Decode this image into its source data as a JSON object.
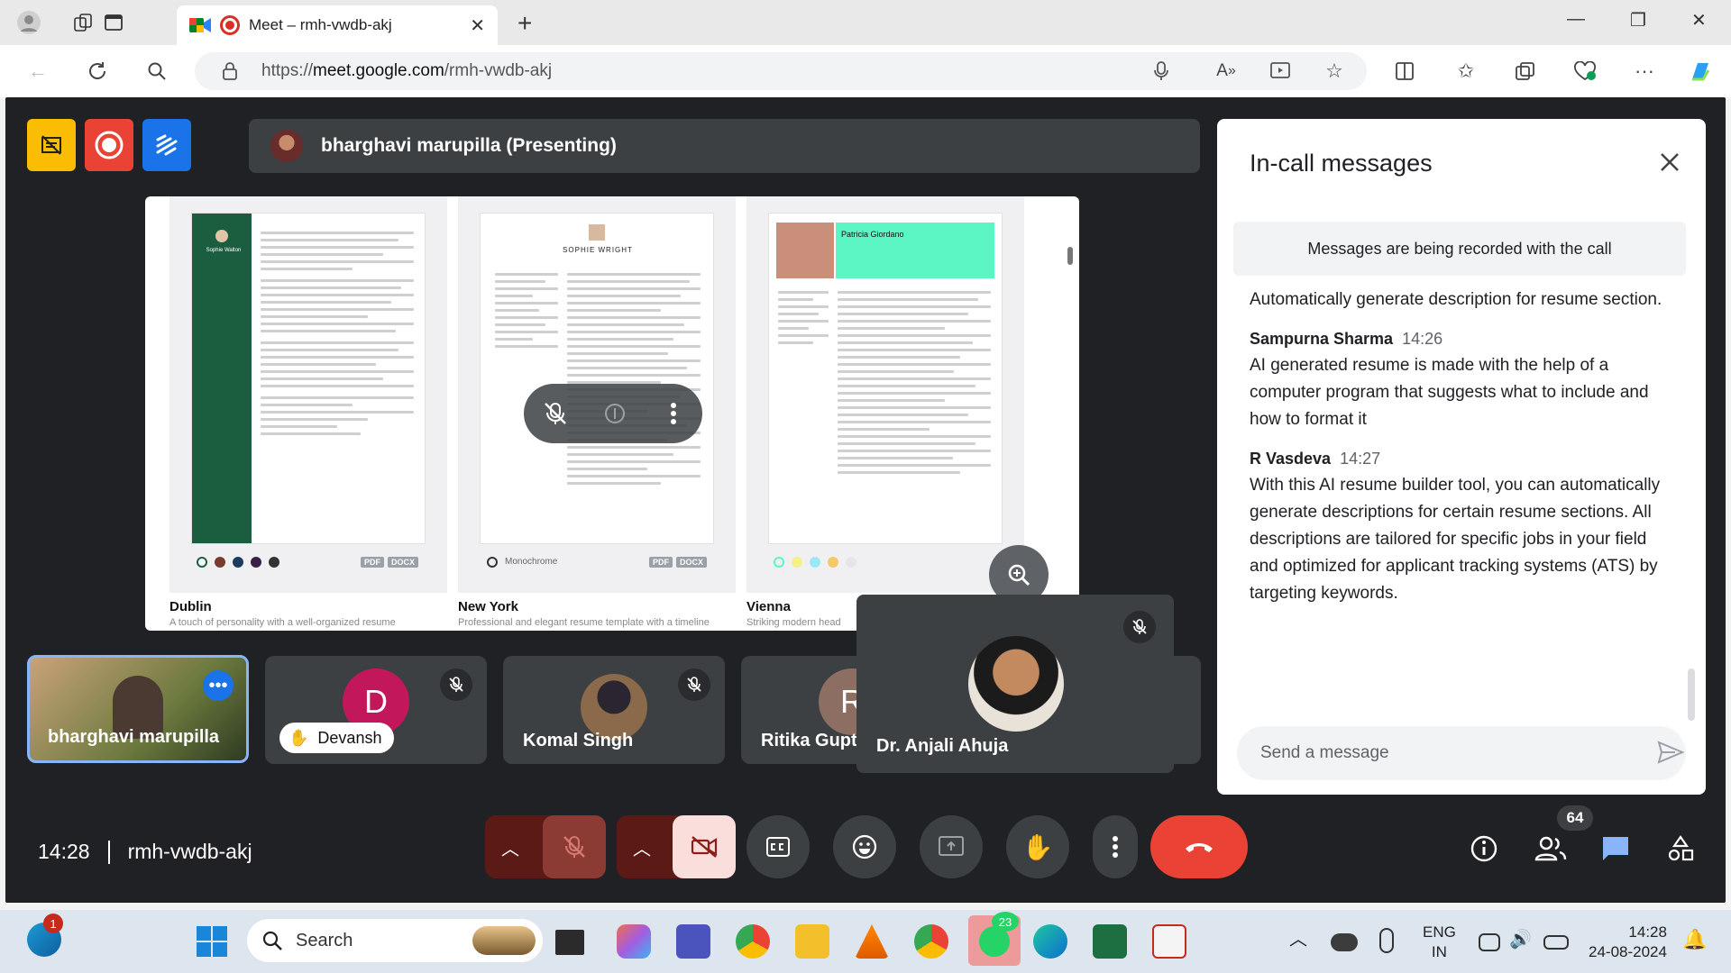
{
  "browser": {
    "tab_title": "Meet – rmh-vwdb-akj",
    "url_prefix": "https://",
    "url_host": "meet.google.com",
    "url_path": "/rmh-vwdb-akj"
  },
  "meet": {
    "presenter_banner": "bharghavi marupilla (Presenting)",
    "meeting_time": "14:28",
    "meeting_code": "rmh-vwdb-akj",
    "participant_count": "64",
    "colors": {
      "end_call": "#ea4335",
      "bg": "#202124",
      "tile": "#3c4043"
    }
  },
  "shared_screen": {
    "templates": [
      {
        "name": "Dublin",
        "description": "A touch of personality with a well-organized resume",
        "header_name": "Sophie Walton",
        "swatches": [
          "#ffffff",
          "#7a3b2e",
          "#1f3a5f",
          "#3b1f45",
          "#333333"
        ]
      },
      {
        "name": "New York",
        "description": "Professional and elegant resume template with a timeline",
        "header_name": "SOPHIE WRIGHT",
        "variant": "Monochrome"
      },
      {
        "name": "Vienna",
        "description": "Striking modern head",
        "header_name": "Patricia Giordano",
        "swatches": [
          "#ffffff",
          "#f5f08a",
          "#9be7f5",
          "#f5c96b",
          "#e6e6e6"
        ]
      }
    ],
    "format_pdf": "PDF",
    "format_docx": "DOCX"
  },
  "participants": [
    {
      "name": "bharghavi marupilla"
    },
    {
      "name": "Devansh",
      "initial": "D",
      "color": "#c2185b"
    },
    {
      "name": "Komal Singh"
    },
    {
      "name": "Ritika Gupt",
      "initial": "R",
      "color": "#8d6e63"
    },
    {
      "name": "Dr. Anjali Ahuja"
    }
  ],
  "chat": {
    "title": "In-call messages",
    "recording_note": "Messages are being recorded with the call",
    "messages": [
      {
        "sender": "",
        "time": "",
        "text": "Automatically generate description for resume section."
      },
      {
        "sender": "Sampurna Sharma",
        "time": "14:26",
        "text": "AI generated resume is made with the help of a computer program that suggests what to include and how to format it"
      },
      {
        "sender": "R Vasdeva",
        "time": "14:27",
        "text": "With this AI resume builder tool, you can automatically generate descriptions for certain resume sections. All descriptions are tailored for specific jobs in your field and optimized for applicant tracking systems (ATS) by targeting keywords."
      }
    ],
    "input_placeholder": "Send a message"
  },
  "taskbar": {
    "search_label": "Search",
    "widget_badge": "1",
    "whatsapp_badge": "23",
    "language_line1": "ENG",
    "language_line2": "IN",
    "clock_time": "14:28",
    "clock_date": "24-08-2024"
  }
}
